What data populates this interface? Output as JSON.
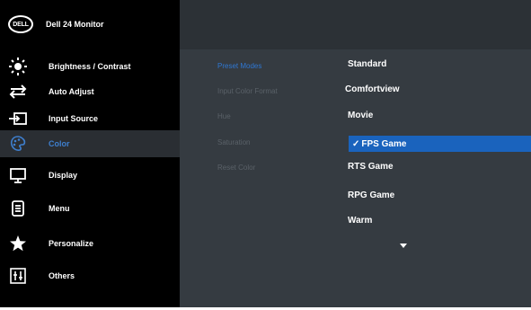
{
  "header": {
    "logo": "DELL",
    "model": "Dell 24 Monitor"
  },
  "sidebar": {
    "items": [
      {
        "label": "Brightness / Contrast",
        "icon": "brightness-icon"
      },
      {
        "label": "Auto Adjust",
        "icon": "auto-adjust-icon"
      },
      {
        "label": "Input Source",
        "icon": "input-source-icon"
      },
      {
        "label": "Color",
        "icon": "color-palette-icon",
        "active": true
      },
      {
        "label": "Display",
        "icon": "display-icon"
      },
      {
        "label": "Menu",
        "icon": "menu-icon"
      },
      {
        "label": "Personalize",
        "icon": "star-icon"
      },
      {
        "label": "Others",
        "icon": "others-icon"
      }
    ]
  },
  "color_options": [
    {
      "label": "Preset Modes",
      "active": true
    },
    {
      "label": "Input Color Format"
    },
    {
      "label": "Hue"
    },
    {
      "label": "Saturation"
    },
    {
      "label": "Reset Color"
    }
  ],
  "preset_modes": [
    {
      "label": "Standard"
    },
    {
      "label": "Comfortview"
    },
    {
      "label": "Movie"
    },
    {
      "label": "FPS Game",
      "selected": true,
      "check": "✓"
    },
    {
      "label": "RTS Game"
    },
    {
      "label": "RPG Game"
    },
    {
      "label": "Warm"
    }
  ],
  "more_indicator": "scroll-down-arrow",
  "colors": {
    "accent": "#1a63bd",
    "active_text": "#2f77d2",
    "panel": "#353b41",
    "sidebar": "#000000"
  }
}
